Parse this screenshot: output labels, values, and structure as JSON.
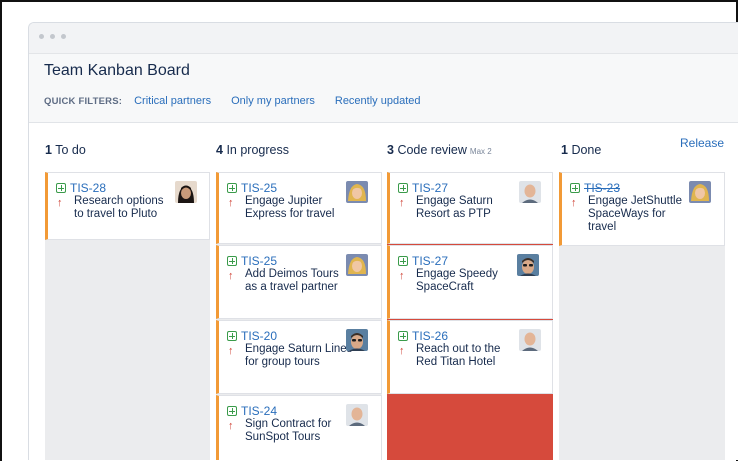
{
  "board": {
    "title": "Team Kanban Board"
  },
  "filters": {
    "label": "QUICK FILTERS:",
    "items": [
      "Critical partners",
      "Only my partners",
      "Recently updated"
    ]
  },
  "release_label": "Release",
  "columns": [
    {
      "count": "1",
      "name": "To do"
    },
    {
      "count": "4",
      "name": "In progress"
    },
    {
      "count": "3",
      "name": "Code review",
      "max": "Max 2"
    },
    {
      "count": "1",
      "name": "Done"
    }
  ],
  "cards": {
    "todo": [
      {
        "key": "TIS-28",
        "summary": "Research options to travel to Pluto",
        "avatar": "avatar-dark-hair"
      }
    ],
    "in_progress": [
      {
        "key": "TIS-25",
        "summary": "Engage Jupiter Express for travel",
        "avatar": "avatar-blonde"
      },
      {
        "key": "TIS-25",
        "summary": "Add Deimos Tours as a travel partner",
        "avatar": "avatar-blonde"
      },
      {
        "key": "TIS-20",
        "summary": "Engage Saturn Lines for group tours",
        "avatar": "avatar-sunglasses"
      },
      {
        "key": "TIS-24",
        "summary": "Sign Contract for SunSpot Tours",
        "avatar": "avatar-bald"
      }
    ],
    "code_review": [
      {
        "key": "TIS-27",
        "summary": "Engage Saturn Resort as PTP",
        "avatar": "avatar-bald"
      },
      {
        "key": "TIS-27",
        "summary": "Engage Speedy SpaceCraft",
        "avatar": "avatar-sunglasses"
      },
      {
        "key": "TIS-26",
        "summary": "Reach out to the Red Titan Hotel",
        "avatar": "avatar-bald"
      }
    ],
    "done": [
      {
        "key": "TIS-23",
        "summary": "Engage JetShuttle SpaceWays for travel",
        "avatar": "avatar-blonde"
      }
    ]
  },
  "colors": {
    "accent_link": "#2a6ebb",
    "card_stripe": "#f29a36",
    "priority": "#d04437",
    "review_over_limit": "#d64a3c"
  }
}
